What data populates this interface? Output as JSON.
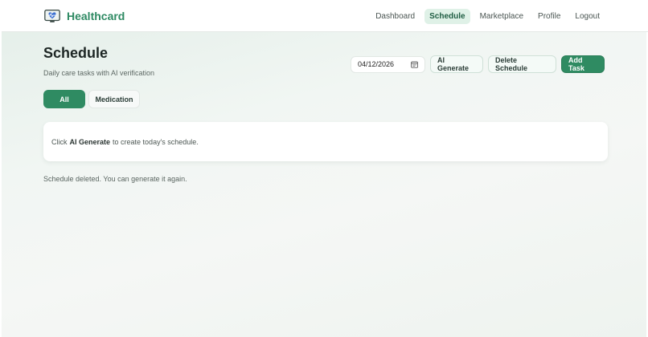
{
  "app": {
    "brand": "Healthcard",
    "logo_icon": "heart-monitor-icon",
    "accent": "#2f8b62"
  },
  "nav": {
    "items": [
      {
        "label": "Dashboard",
        "active": false
      },
      {
        "label": "Schedule",
        "active": true
      },
      {
        "label": "Marketplace",
        "active": false
      },
      {
        "label": "Profile",
        "active": false
      },
      {
        "label": "Logout",
        "active": false
      }
    ]
  },
  "header": {
    "title": "Schedule",
    "subtitle": "Daily care tasks with AI verification"
  },
  "toolbar": {
    "date_value": "04/12/2026",
    "date_icon": "calendar-icon",
    "ai_generate_label": "AI Generate",
    "delete_label": "Delete Schedule",
    "add_task_label": "Add Task"
  },
  "filters": {
    "all_label": "All",
    "medication_label": "Medication",
    "selected": "All"
  },
  "empty_card": {
    "prefix": "Click",
    "highlight": "AI Generate",
    "suffix": "to create today's schedule."
  },
  "status_message": "Schedule deleted. You can generate it again."
}
